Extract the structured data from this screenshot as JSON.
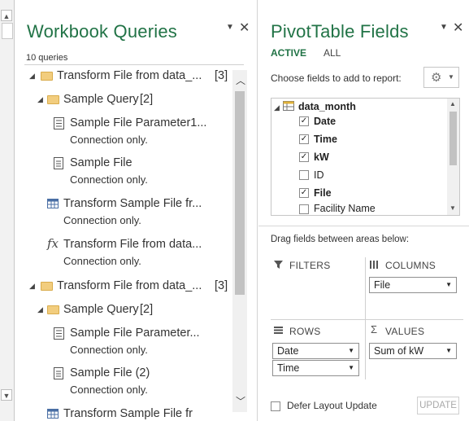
{
  "left_strip": {
    "up_icon": "scroll-up-icon",
    "down_icon": "scroll-down-icon"
  },
  "queries_pane": {
    "title": "Workbook Queries",
    "count": "10 queries",
    "items": [
      {
        "kind": "group",
        "label": "Transform File from data_...",
        "count": "[3]"
      },
      {
        "kind": "subgroup",
        "label": "Sample Query",
        "count": "[2]"
      },
      {
        "kind": "query",
        "icon": "parameter-icon",
        "label": "Sample File Parameter1...",
        "sub": "Connection only."
      },
      {
        "kind": "query",
        "icon": "file-icon",
        "label": "Sample File",
        "sub": "Connection only."
      },
      {
        "kind": "query",
        "icon": "table-icon",
        "label": "Transform Sample File fr...",
        "sub": "Connection only."
      },
      {
        "kind": "query",
        "icon": "function-icon",
        "label": "Transform File from data...",
        "sub": "Connection only."
      },
      {
        "kind": "group",
        "label": "Transform File from data_...",
        "count": "[3]"
      },
      {
        "kind": "subgroup",
        "label": "Sample Query",
        "count": "[2]"
      },
      {
        "kind": "query",
        "icon": "parameter-icon",
        "label": "Sample File Parameter...",
        "sub": "Connection only."
      },
      {
        "kind": "query",
        "icon": "file-icon",
        "label": "Sample File (2)",
        "sub": "Connection only."
      },
      {
        "kind": "query",
        "icon": "table-icon",
        "label": "Transform Sample File fr",
        "sub": ""
      }
    ]
  },
  "pivot_pane": {
    "title": "PivotTable Fields",
    "tabs": [
      "ACTIVE",
      "ALL"
    ],
    "choose_label": "Choose fields to add to report:",
    "table_name": "data_month",
    "fields": [
      {
        "label": "Date",
        "checked": true
      },
      {
        "label": "Time",
        "checked": true
      },
      {
        "label": "kW",
        "checked": true
      },
      {
        "label": "ID",
        "checked": false
      },
      {
        "label": "File",
        "checked": true
      },
      {
        "label": "Facility Name",
        "checked": false
      }
    ],
    "drag_label": "Drag fields between areas below:",
    "filters_label": "FILTERS",
    "columns_label": "COLUMNS",
    "rows_label": "ROWS",
    "values_label": "VALUES",
    "columns_items": [
      "File"
    ],
    "rows_items": [
      "Date",
      "Time"
    ],
    "values_items": [
      "Sum of kW"
    ],
    "defer_label": "Defer Layout Update",
    "update_label": "UPDATE"
  },
  "colors": {
    "accent": "#217346",
    "folder": "#f2cd7e"
  }
}
